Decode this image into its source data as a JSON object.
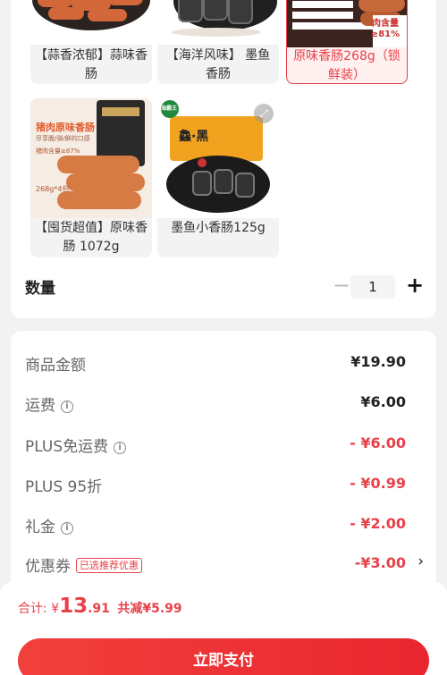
{
  "variants": [
    {
      "label": "【蒜香浓郁】蒜味香肠"
    },
    {
      "label": "【海洋风味】 墨鱼香肠"
    },
    {
      "label": "原味香肠268g（锁鲜装）",
      "selected": true,
      "pkg_text": [
        "肉含量",
        "≥81%"
      ]
    },
    {
      "label": "【囤货超值】原味香肠 1072g",
      "pkg_text": [
        "猪肉原味香肠",
        "尽享脆/弹/鲜的口感",
        "猪肉含量≥87%",
        "268g*4包"
      ]
    },
    {
      "label": "墨鱼小香肠125g",
      "pkg_text": [
        "海霸王",
        "鱻·黑"
      ]
    }
  ],
  "quantity": {
    "label": "数量",
    "value": "1",
    "minus": "−",
    "plus": "+"
  },
  "price_rows": [
    {
      "label": "商品金额",
      "value": "¥19.90"
    },
    {
      "label": "运费",
      "value": "¥6.00",
      "info": true
    },
    {
      "label": "PLUS免运费",
      "value": "- ¥6.00",
      "info": true,
      "red": true
    },
    {
      "label": "PLUS 95折",
      "value": "- ¥0.99",
      "red": true
    },
    {
      "label": "礼金",
      "value": "- ¥2.00",
      "info": true,
      "red": true
    },
    {
      "label": "优惠券",
      "value": "-¥3.00",
      "badge": "已选推荐优惠",
      "red": true,
      "chevron": "›"
    }
  ],
  "footer": {
    "total_prefix": "合计: ¥",
    "total_int": "13",
    "total_dec": ".91",
    "saved": "共减¥5.99",
    "pay_label": "立即支付"
  },
  "colors": {
    "accent": "#e8414a",
    "bg": "#f2f2f2"
  },
  "icons": {
    "info": "info-icon",
    "expand": "expand-icon",
    "chevron": "chevron-right-icon"
  }
}
